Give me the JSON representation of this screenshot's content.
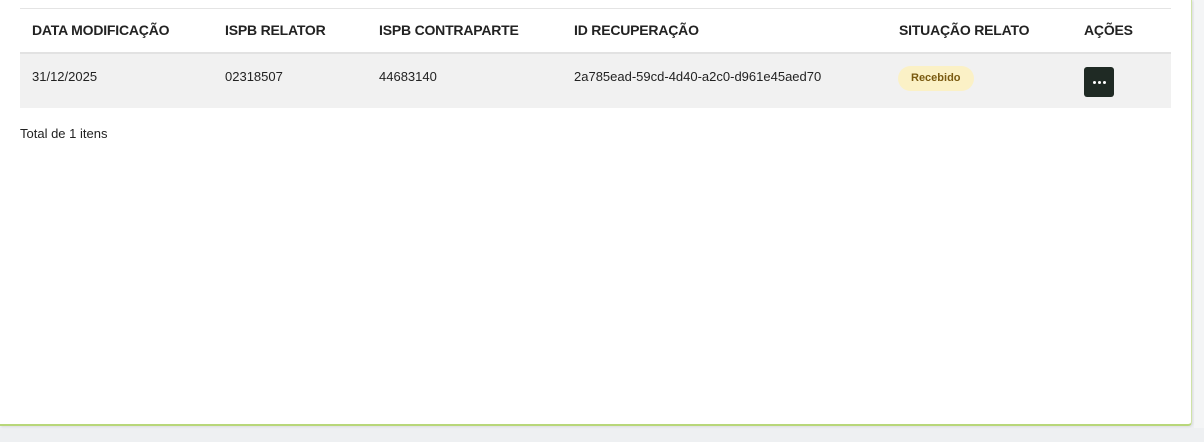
{
  "table": {
    "headers": [
      "DATA MODIFICAÇÃO",
      "ISPB RELATOR",
      "ISPB CONTRAPARTE",
      "ID RECUPERAÇÃO",
      "SITUAÇÃO RELATO",
      "AÇÕES"
    ],
    "rows": [
      {
        "data_modificacao": "31/12/2025",
        "ispb_relator": "02318507",
        "ispb_contraparte": "44683140",
        "id_recuperacao": "2a785ead-59cd-4d40-a2c0-d961e45aed70",
        "situacao": "Recebido",
        "action_icon": "more-horizontal-icon"
      }
    ]
  },
  "footer": {
    "total_text": "Total de 1 itens"
  },
  "colors": {
    "badge_bg": "#fbf1c6",
    "badge_text": "#7a5a10",
    "action_button_bg": "#1f2a24",
    "row_bg": "#f1f1f1",
    "card_accent_border": "#b8d77a"
  }
}
